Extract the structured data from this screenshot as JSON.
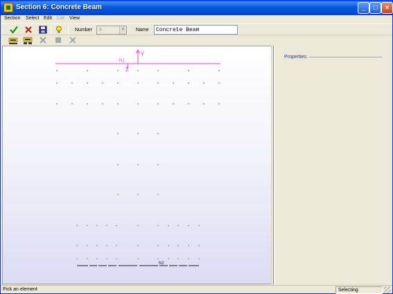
{
  "window": {
    "title": "Section 6: Concrete Beam"
  },
  "menu": {
    "items": [
      {
        "label": "Section",
        "enabled": true
      },
      {
        "label": "Select",
        "enabled": true
      },
      {
        "label": "Edit",
        "enabled": true
      },
      {
        "label": "List",
        "enabled": false
      },
      {
        "label": "View",
        "enabled": true
      }
    ]
  },
  "toolbar": {
    "number_label": "Number",
    "number_value": "6",
    "name_label": "Name",
    "name_value": "Concrete Beam",
    "icons": [
      "ok-check-icon",
      "cancel-x-icon",
      "save-disk-icon",
      "help-bulb-icon",
      "add-element-icon",
      "add-group-icon",
      "delete-element-icon",
      "stop-icon",
      "tool-icon"
    ]
  },
  "canvas": {
    "axis_y_label": "Y",
    "axis_z_label": "Z",
    "node_top_label": "N1",
    "node_bottom_label": "N2",
    "colors": {
      "axis": "#E840E0",
      "grid_point": "#B8B8B8",
      "node_label": "#1010A0"
    }
  },
  "properties": {
    "label": "Properties:"
  },
  "status": {
    "left": "Pick an element",
    "right": "Selecting"
  }
}
